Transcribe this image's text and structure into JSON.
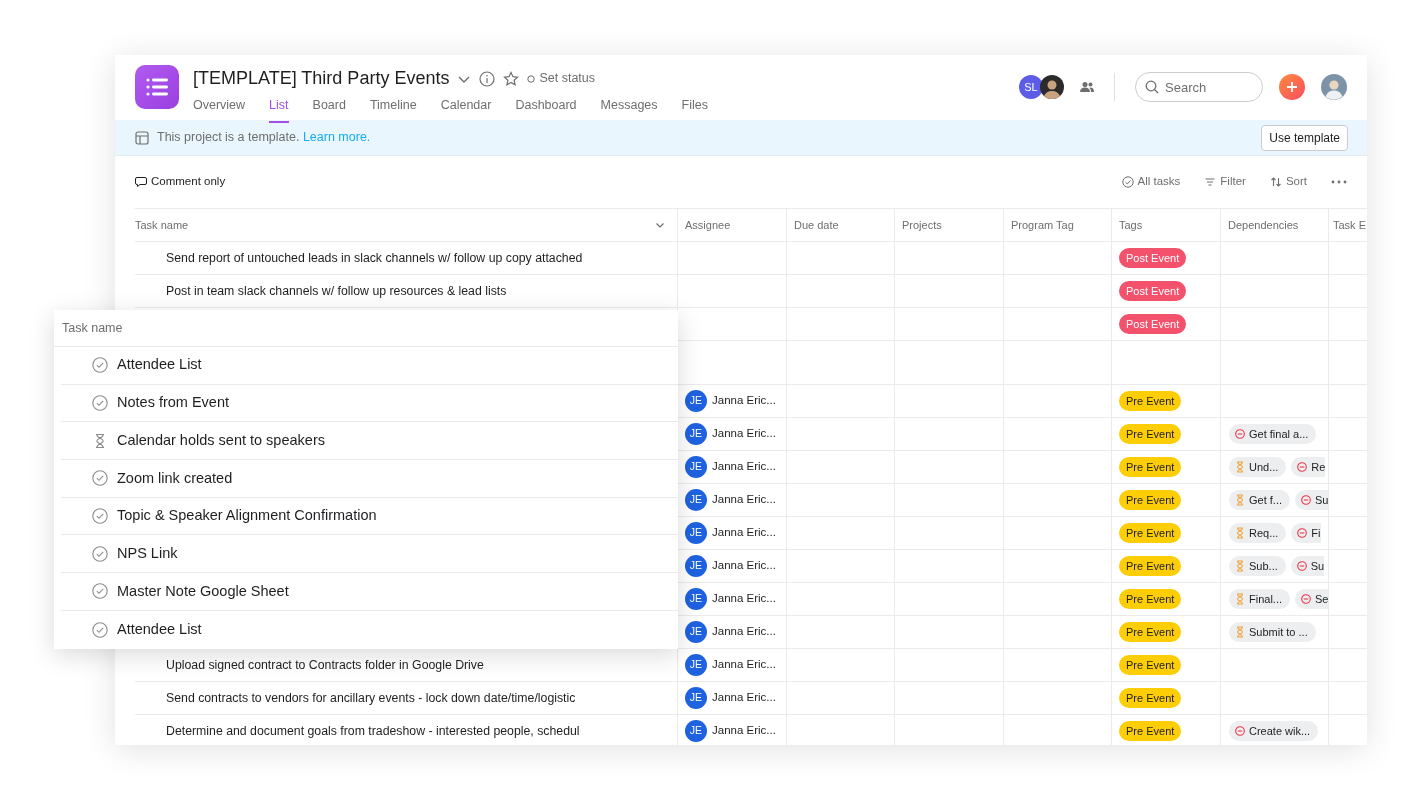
{
  "project": {
    "title": "[TEMPLATE] Third Party Events",
    "status_label": "Set status",
    "tabs": [
      {
        "label": "Overview",
        "selected": false
      },
      {
        "label": "List",
        "selected": true
      },
      {
        "label": "Board",
        "selected": false
      },
      {
        "label": "Timeline",
        "selected": false
      },
      {
        "label": "Calendar",
        "selected": false
      },
      {
        "label": "Dashboard",
        "selected": false
      },
      {
        "label": "Messages",
        "selected": false
      },
      {
        "label": "Files",
        "selected": false
      }
    ]
  },
  "members": [
    {
      "kind": "initials",
      "initials": "SL",
      "color": "#5d5ce6"
    },
    {
      "kind": "photo"
    }
  ],
  "search": {
    "placeholder": "Search"
  },
  "banner": {
    "text": "This project is a template. ",
    "link": "Learn more.",
    "button": "Use template"
  },
  "toolbar": {
    "comment": "Comment only",
    "actions": [
      {
        "kind": "check",
        "label": "All tasks"
      },
      {
        "kind": "filter",
        "label": "Filter"
      },
      {
        "kind": "sort",
        "label": "Sort"
      }
    ]
  },
  "table": {
    "columns": [
      "Task name",
      "Assignee",
      "Due date",
      "Projects",
      "Program Tag",
      "Tags",
      "Dependencies",
      "Task E"
    ],
    "rows": [
      {
        "kind": "task",
        "task_name": "Send report of untouched leads in slack channels w/ follow up copy attached",
        "tag": {
          "label": "Post Event",
          "color": "#f4516c"
        }
      },
      {
        "kind": "task",
        "task_name": "Post in team slack channels w/ follow up resources & lead lists",
        "tag": {
          "label": "Post Event",
          "color": "#f4516c"
        }
      },
      {
        "kind": "task",
        "tag": {
          "label": "Post Event",
          "color": "#f4516c"
        }
      },
      {
        "kind": "section"
      },
      {
        "kind": "task",
        "assignee": {
          "initials": "JE",
          "name": "Janna Eric..."
        },
        "tag": {
          "label": "Pre Event",
          "color": "#fdcd05"
        }
      },
      {
        "kind": "task",
        "assignee": {
          "initials": "JE",
          "name": "Janna Eric..."
        },
        "tag": {
          "label": "Pre Event",
          "color": "#fdcd05"
        },
        "dependencies": [
          {
            "kind": "blocked",
            "label": "Get final a..."
          }
        ]
      },
      {
        "kind": "task",
        "assignee": {
          "initials": "JE",
          "name": "Janna Eric..."
        },
        "tag": {
          "label": "Pre Event",
          "color": "#fdcd05"
        },
        "dependencies": [
          {
            "kind": "waiting",
            "label": "Und..."
          },
          {
            "kind": "blocked",
            "label": "Re"
          }
        ]
      },
      {
        "kind": "task",
        "assignee": {
          "initials": "JE",
          "name": "Janna Eric..."
        },
        "tag": {
          "label": "Pre Event",
          "color": "#fdcd05"
        },
        "dependencies": [
          {
            "kind": "waiting",
            "label": "Get f..."
          },
          {
            "kind": "blocked",
            "label": "Su"
          }
        ]
      },
      {
        "kind": "task",
        "assignee": {
          "initials": "JE",
          "name": "Janna Eric..."
        },
        "tag": {
          "label": "Pre Event",
          "color": "#fdcd05"
        },
        "dependencies": [
          {
            "kind": "waiting",
            "label": "Req..."
          },
          {
            "kind": "blocked",
            "label": "Fi"
          }
        ]
      },
      {
        "kind": "task",
        "assignee": {
          "initials": "JE",
          "name": "Janna Eric..."
        },
        "tag": {
          "label": "Pre Event",
          "color": "#fdcd05"
        },
        "dependencies": [
          {
            "kind": "waiting",
            "label": "Sub..."
          },
          {
            "kind": "blocked",
            "label": "Su"
          }
        ]
      },
      {
        "kind": "task",
        "assignee": {
          "initials": "JE",
          "name": "Janna Eric..."
        },
        "tag": {
          "label": "Pre Event",
          "color": "#fdcd05"
        },
        "dependencies": [
          {
            "kind": "waiting",
            "label": "Final..."
          },
          {
            "kind": "blocked",
            "label": "Se"
          }
        ]
      },
      {
        "kind": "task",
        "assignee": {
          "initials": "JE",
          "name": "Janna Eric..."
        },
        "tag": {
          "label": "Pre Event",
          "color": "#fdcd05"
        },
        "dependencies": [
          {
            "kind": "waiting",
            "label": "Submit to ..."
          }
        ]
      },
      {
        "kind": "task",
        "task_name": "Upload signed contract to Contracts folder in Google Drive",
        "assignee": {
          "initials": "JE",
          "name": "Janna Eric..."
        },
        "tag": {
          "label": "Pre Event",
          "color": "#fdcd05"
        }
      },
      {
        "kind": "task",
        "task_name": "Send contracts to vendors for ancillary events - lock down date/time/logistic",
        "assignee": {
          "initials": "JE",
          "name": "Janna Eric..."
        },
        "tag": {
          "label": "Pre Event",
          "color": "#fdcd05"
        }
      },
      {
        "kind": "task",
        "task_name": "Determine and document goals from tradeshow - interested people, schedul",
        "assignee": {
          "initials": "JE",
          "name": "Janna Eric..."
        },
        "tag": {
          "label": "Pre Event",
          "color": "#fdcd05"
        },
        "dependencies": [
          {
            "kind": "blocked",
            "label": "Create wik..."
          }
        ]
      }
    ]
  },
  "overlay": {
    "header": "Task name",
    "items": [
      {
        "kind": "done",
        "label": "Attendee List"
      },
      {
        "kind": "done",
        "label": "Notes from Event"
      },
      {
        "kind": "waiting",
        "label": "Calendar holds sent to speakers"
      },
      {
        "kind": "done",
        "label": "Zoom link created"
      },
      {
        "kind": "done",
        "label": "Topic & Speaker Alignment Confirmation"
      },
      {
        "kind": "done",
        "label": "NPS Link"
      },
      {
        "kind": "done",
        "label": "Master Note Google Sheet"
      },
      {
        "kind": "done",
        "label": "Attendee List"
      }
    ]
  }
}
